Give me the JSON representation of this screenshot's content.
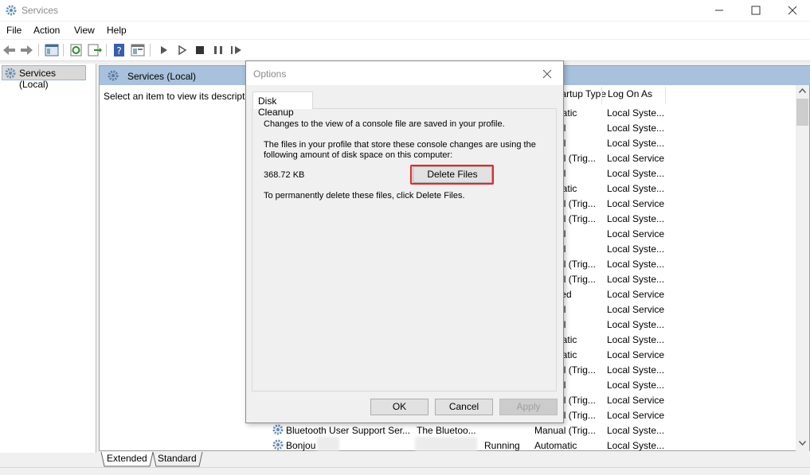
{
  "window": {
    "title": "Services"
  },
  "menu": [
    "File",
    "Action",
    "View",
    "Help"
  ],
  "tree": {
    "root_label": "Services (Local)"
  },
  "right_pane": {
    "header": "Services (Local)",
    "description": "Select an item to view its description."
  },
  "columns": {
    "startup_type": "Startup Type",
    "log_on_as": "Log On As"
  },
  "rows": [
    {
      "startup": "Automatic",
      "logon": "Local Syste..."
    },
    {
      "startup": "Manual",
      "logon": "Local Syste..."
    },
    {
      "startup": "Manual",
      "logon": "Local Syste..."
    },
    {
      "startup": "Manual (Trig...",
      "logon": "Local Service"
    },
    {
      "startup": "Manual",
      "logon": "Local Syste..."
    },
    {
      "startup": "Automatic",
      "logon": "Local Syste..."
    },
    {
      "startup": "Manual (Trig...",
      "logon": "Local Service"
    },
    {
      "startup": "Manual (Trig...",
      "logon": "Local Syste..."
    },
    {
      "startup": "Manual",
      "logon": "Local Service"
    },
    {
      "startup": "Manual",
      "logon": "Local Syste..."
    },
    {
      "startup": "Manual (Trig...",
      "logon": "Local Syste..."
    },
    {
      "startup": "Manual (Trig...",
      "logon": "Local Syste..."
    },
    {
      "startup": "Disabled",
      "logon": "Local Service"
    },
    {
      "startup": "Manual",
      "logon": "Local Service"
    },
    {
      "startup": "Manual",
      "logon": "Local Syste..."
    },
    {
      "startup": "Automatic",
      "logon": "Local Syste..."
    },
    {
      "startup": "Automatic",
      "logon": "Local Service"
    },
    {
      "startup": "Manual (Trig...",
      "logon": "Local Syste..."
    },
    {
      "startup": "Manual",
      "logon": "Local Syste..."
    },
    {
      "startup": "Manual (Trig...",
      "logon": "Local Service"
    },
    {
      "startup": "Manual (Trig...",
      "logon": "Local Service"
    }
  ],
  "visible_rows": [
    {
      "name": "Bluetooth User Support Ser...",
      "description": "The Bluetoo...",
      "status": "",
      "startup": "Manual (Trig...",
      "logon": "Local Syste..."
    },
    {
      "name": "Bonjou",
      "description": "",
      "status": "Running",
      "startup": "Automatic",
      "logon": "Local Syste..."
    }
  ],
  "bottom_tabs": [
    "Extended",
    "Standard"
  ],
  "dialog": {
    "title": "Options",
    "tab": "Disk Cleanup",
    "line1": "Changes to the view of a console file are saved in your profile.",
    "line2a": "The files in your profile that store these console changes are using the",
    "line2b": "following amount of disk space on this computer:",
    "size": "368.72 KB",
    "delete_button": "Delete Files",
    "line3": "To permanently delete these files, click Delete Files.",
    "ok": "OK",
    "cancel": "Cancel",
    "apply": "Apply"
  },
  "colors": {
    "highlight": "#e8262a",
    "pane_header": "#a8c1dc"
  }
}
